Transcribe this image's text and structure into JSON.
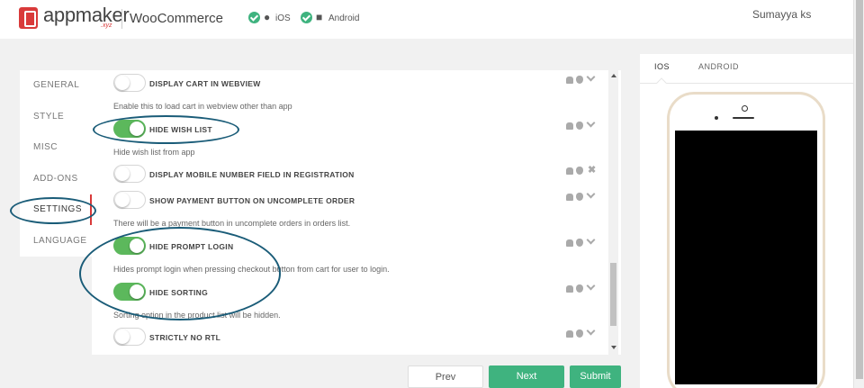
{
  "header": {
    "brand": "appmaker",
    "brand_suffix": ".xyz",
    "platform": "WooCommerce",
    "platforms": [
      {
        "label": "iOS",
        "icon": "apple-icon",
        "checked": true
      },
      {
        "label": "Android",
        "icon": "android-icon",
        "checked": true
      }
    ],
    "user": "Sumayya ks"
  },
  "sidebar": {
    "items": [
      {
        "label": "GENERAL",
        "active": false
      },
      {
        "label": "STYLE",
        "active": false
      },
      {
        "label": "MISC",
        "active": false
      },
      {
        "label": "ADD-ONS",
        "active": false
      },
      {
        "label": "SETTINGS",
        "active": true
      },
      {
        "label": "LANGUAGE",
        "active": false
      }
    ]
  },
  "settings": [
    {
      "label": "DISPLAY CART IN WEBVIEW",
      "enabled": false,
      "description": "Enable this to load cart in webview other than app",
      "icons": [
        "android-icon",
        "apple-icon",
        "chevron-down-icon"
      ]
    },
    {
      "label": "HIDE WISH LIST",
      "enabled": true,
      "description": "Hide wish list from app",
      "icons": [
        "android-icon",
        "apple-icon",
        "chevron-down-icon"
      ]
    },
    {
      "label": "DISPLAY MOBILE NUMBER FIELD IN REGISTRATION",
      "enabled": false,
      "description": "",
      "icons": [
        "android-icon",
        "apple-icon",
        "close-icon"
      ]
    },
    {
      "label": "SHOW PAYMENT BUTTON ON UNCOMPLETE ORDER",
      "enabled": false,
      "description": "There will be a payment button in uncomplete orders in orders list.",
      "icons": [
        "android-icon",
        "apple-icon",
        "chevron-down-icon"
      ]
    },
    {
      "label": "HIDE PROMPT LOGIN",
      "enabled": true,
      "description": "Hides prompt login when pressing checkout button from cart for user to login.",
      "icons": [
        "android-icon",
        "apple-icon",
        "chevron-down-icon"
      ]
    },
    {
      "label": "HIDE SORTING",
      "enabled": true,
      "description": "Sorting option in the product list will be hidden.",
      "icons": [
        "android-icon",
        "apple-icon",
        "chevron-down-icon"
      ]
    },
    {
      "label": "STRICTLY NO RTL",
      "enabled": false,
      "description": "",
      "icons": [
        "android-icon",
        "apple-icon",
        "chevron-down-icon"
      ]
    }
  ],
  "buttons": {
    "prev": "Prev",
    "next": "Next",
    "submit": "Submit"
  },
  "preview": {
    "tabs": [
      {
        "label": "IOS",
        "active": true
      },
      {
        "label": "ANDROID",
        "active": false
      }
    ]
  },
  "colors": {
    "accent_green": "#3fb37f",
    "toggle_on": "#5cb85c",
    "brand_red": "#d93a3a",
    "annotation_blue": "#1a5c78"
  }
}
